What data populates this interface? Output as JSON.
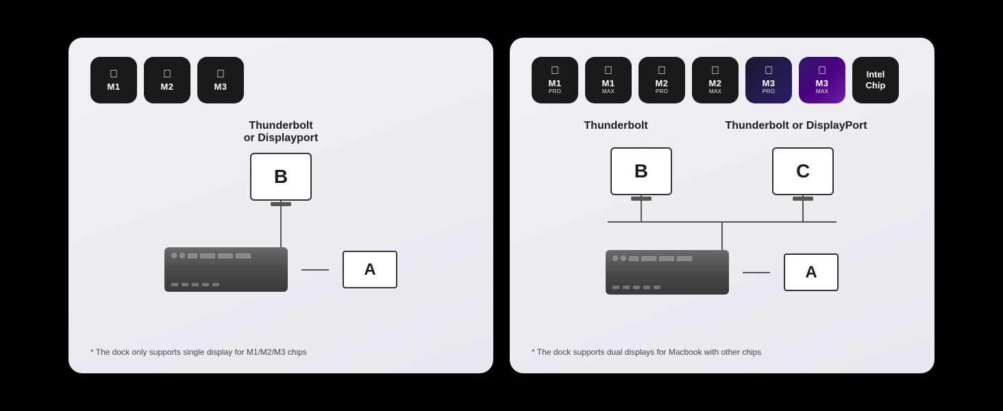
{
  "panels": [
    {
      "id": "single",
      "chips": [
        {
          "label": "M1",
          "sub": "",
          "class": "m1"
        },
        {
          "label": "M2",
          "sub": "",
          "class": "m2"
        },
        {
          "label": "M3",
          "sub": "",
          "class": "m3"
        }
      ],
      "display_label": "Thunderbolt\nor Displayport",
      "monitor_b_label": "B",
      "laptop_a_label": "A",
      "footnote": "* The dock only supports single display for M1/M2/M3 chips"
    },
    {
      "id": "dual",
      "chips": [
        {
          "label": "M1",
          "sub": "PRO",
          "class": "m1-pro"
        },
        {
          "label": "M1",
          "sub": "MAX",
          "class": "m1-max"
        },
        {
          "label": "M2",
          "sub": "PRO",
          "class": "m2-pro"
        },
        {
          "label": "M2",
          "sub": "MAX",
          "class": "m2-max"
        },
        {
          "label": "M3",
          "sub": "PRO",
          "class": "m3-pro"
        },
        {
          "label": "M3",
          "sub": "MAX",
          "class": "m3-max"
        },
        {
          "label": "Intel\nChip",
          "sub": "",
          "class": "intel"
        }
      ],
      "label_b": "Thunderbolt",
      "label_c": "Thunderbolt or DisplayPort",
      "monitor_b_label": "B",
      "monitor_c_label": "C",
      "laptop_a_label": "A",
      "footnote": "* The dock supports dual displays for Macbook with other chips"
    }
  ]
}
